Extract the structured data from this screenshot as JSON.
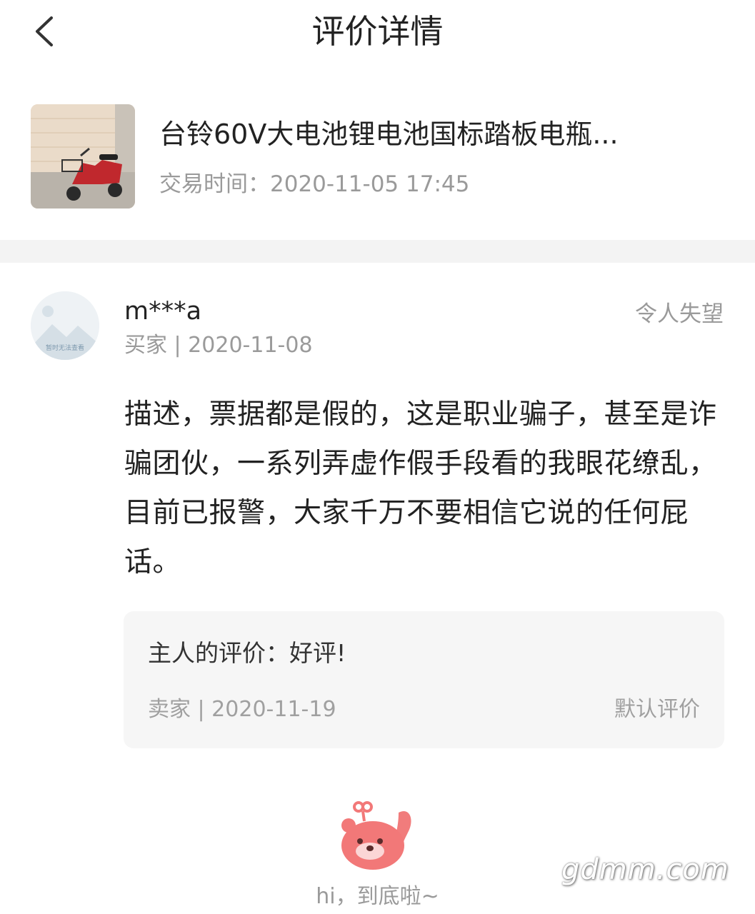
{
  "header": {
    "back_icon": "chevron-left-icon",
    "title": "评价详情"
  },
  "product": {
    "name": "台铃60V大电池锂电池国标踏板电瓶...",
    "trade_time": "交易时间：2020-11-05 17:45"
  },
  "review": {
    "avatar_caption": "暂时无法查看",
    "reviewer_name": "m***a",
    "reviewer_meta": "买家 | 2020-11-08",
    "rating_label": "令人失望",
    "text": "描述，票据都是假的，这是职业骗子，甚至是诈骗团伙，一系列弄虚作假手段看的我眼花缭乱，目前已报警，大家千万不要相信它说的任何屁话。"
  },
  "reply": {
    "text": "主人的评价：好评!",
    "meta": "卖家 | 2020-11-19",
    "tag": "默认评价"
  },
  "footer": {
    "end_text": "hi，到底啦~",
    "watermark": "gdmm.com"
  },
  "colors": {
    "primary_text": "#222222",
    "secondary_text": "#9a9a9a",
    "separator": "#f3f3f3",
    "reply_background": "#f6f6f6",
    "mascot_pink": "#f27878"
  }
}
